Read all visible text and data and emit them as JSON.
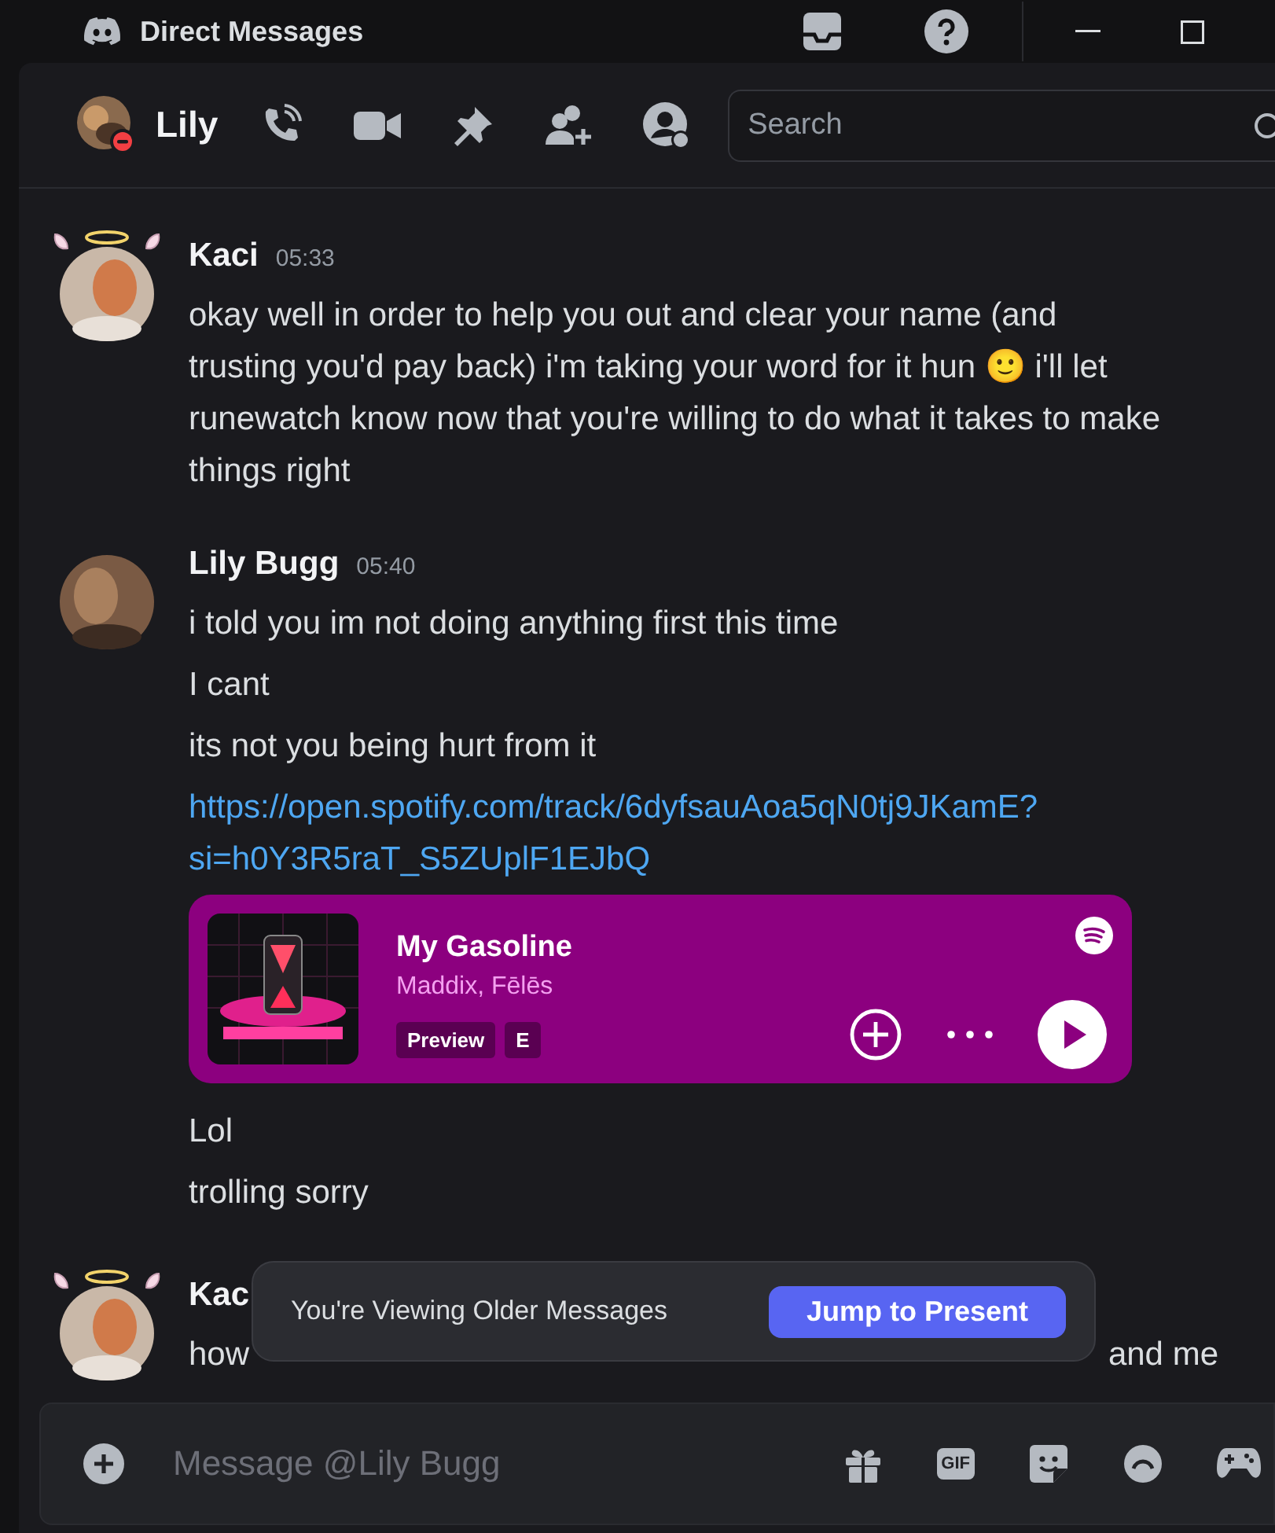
{
  "window": {
    "title": "Direct Messages"
  },
  "header": {
    "name": "Lily",
    "do_not_disturb": true,
    "search": {
      "placeholder": "Search"
    }
  },
  "messages": [
    {
      "author": "Kaci",
      "time": "05:33",
      "halo": true,
      "lines": [
        {
          "kind": "text",
          "text": "okay well in order to help you out and clear your name (and trusting you'd pay back) i'm taking your word for it hun 🙂 i'll let runewatch know now that you're willing to do what it takes to make things right"
        }
      ]
    },
    {
      "author": "Lily Bugg",
      "time": "05:40",
      "halo": false,
      "lines": [
        {
          "kind": "text",
          "text": "i told you im not doing anything first this time"
        },
        {
          "kind": "text",
          "text": "I cant"
        },
        {
          "kind": "text",
          "text": "its not you being hurt from it"
        },
        {
          "kind": "link",
          "text": "https://open.spotify.com/track/6dyfsauAoa5qN0tj9JKamE?si=h0Y3R5raT_S5ZUplF1EJbQ"
        },
        {
          "kind": "embed",
          "title": "My Gasoline",
          "artists": "Maddix, Fēlēs",
          "badges": [
            "Preview",
            "E"
          ]
        },
        {
          "kind": "text",
          "text": "Lol"
        },
        {
          "kind": "text",
          "text": "trolling sorry"
        }
      ]
    },
    {
      "author": "Kac",
      "halo": true,
      "lines": [
        {
          "kind": "split",
          "left": "how",
          "right": "and me"
        }
      ]
    }
  ],
  "toast": {
    "text": "You're Viewing Older Messages",
    "button": "Jump to Present"
  },
  "composer": {
    "placeholder": "Message @Lily Bugg",
    "gif": "GIF"
  }
}
